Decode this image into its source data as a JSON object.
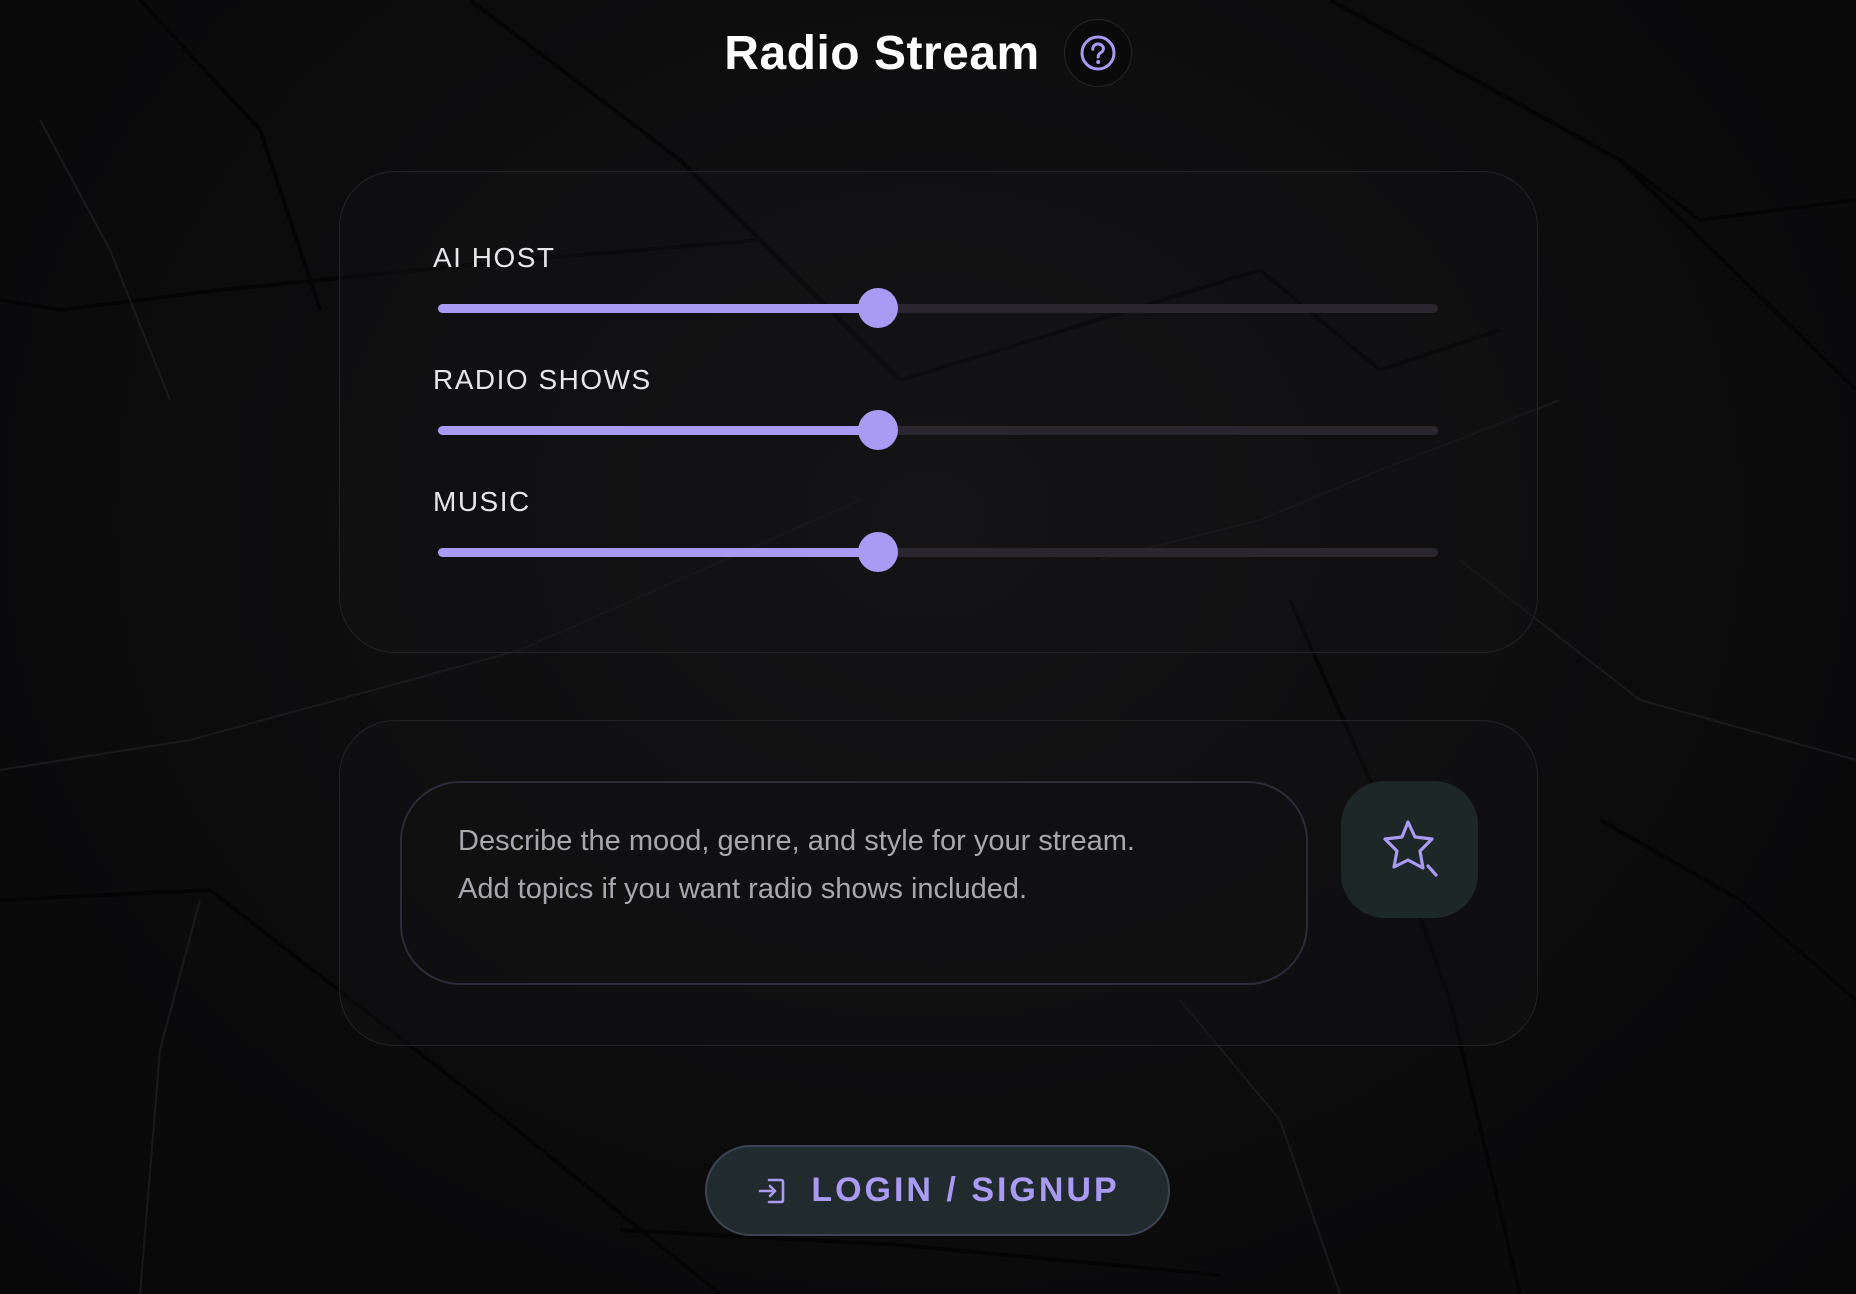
{
  "header": {
    "title": "Radio Stream",
    "help_icon": "help-circle-icon"
  },
  "mix": {
    "sliders": [
      {
        "label": "AI HOST",
        "value": 0.44
      },
      {
        "label": "RADIO SHOWS",
        "value": 0.44
      },
      {
        "label": "MUSIC",
        "value": 0.44
      }
    ]
  },
  "prompt": {
    "value": "",
    "placeholder": "Describe the mood, genre, and style for your stream.\nAdd topics if you want radio shows included.",
    "generate_icon": "sparkle-star-icon"
  },
  "auth": {
    "login_label": "LOGIN / SIGNUP",
    "login_icon": "login-arrow-icon"
  },
  "colors": {
    "accent": "#a99af3",
    "track": "#29262f",
    "background": "#0b0b0c",
    "button_bg": "#212a2c"
  }
}
